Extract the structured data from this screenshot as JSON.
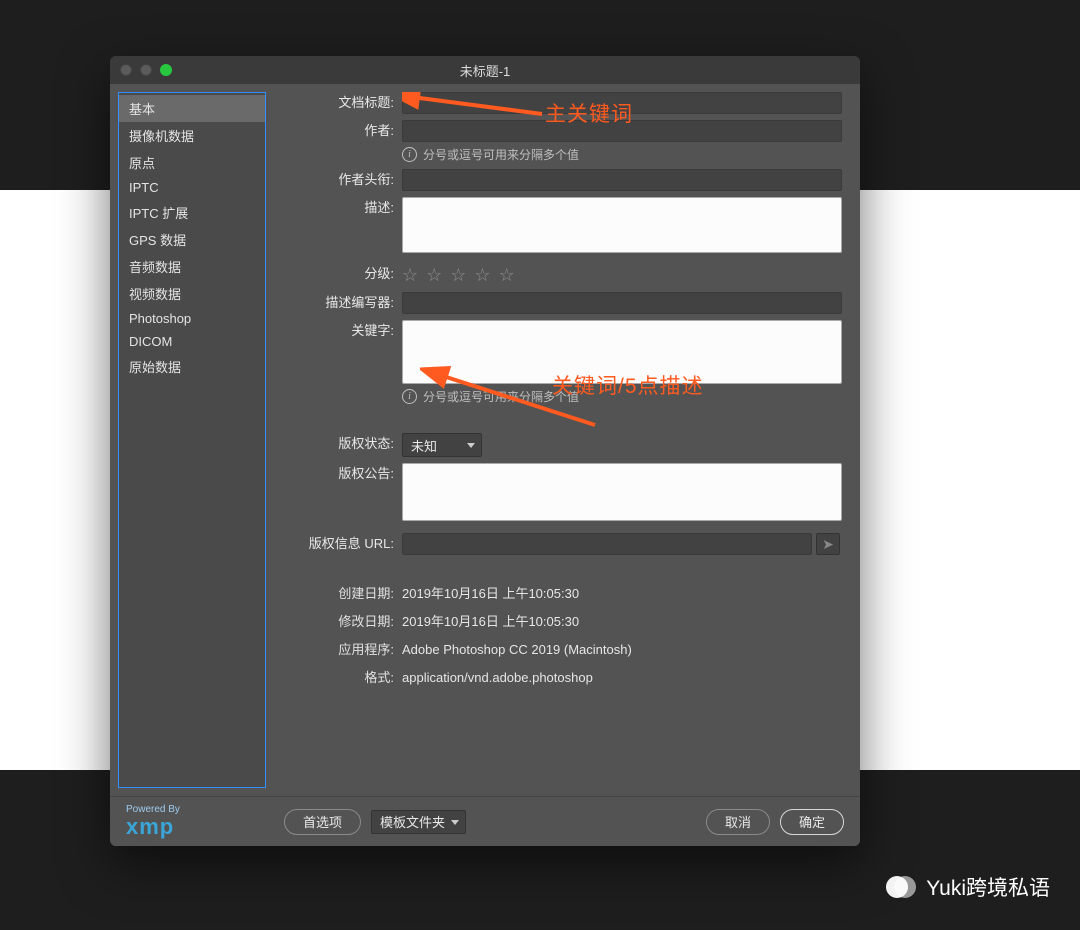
{
  "window": {
    "title": "未标题-1"
  },
  "sidebar": {
    "items": [
      {
        "label": "基本",
        "selected": true
      },
      {
        "label": "摄像机数据"
      },
      {
        "label": "原点"
      },
      {
        "label": "IPTC"
      },
      {
        "label": "IPTC 扩展"
      },
      {
        "label": "GPS 数据"
      },
      {
        "label": "音频数据"
      },
      {
        "label": "视频数据"
      },
      {
        "label": "Photoshop"
      },
      {
        "label": "DICOM"
      },
      {
        "label": "原始数据"
      }
    ]
  },
  "form": {
    "doc_title_label": "文档标题:",
    "author_label": "作者:",
    "multi_hint": "分号或逗号可用来分隔多个值",
    "author_title_label": "作者头衔:",
    "description_label": "描述:",
    "rating_label": "分级:",
    "desc_writer_label": "描述编写器:",
    "keywords_label": "关键字:",
    "copyright_status_label": "版权状态:",
    "copyright_status_value": "未知",
    "copyright_notice_label": "版权公告:",
    "copyright_url_label": "版权信息 URL:",
    "created_label": "创建日期:",
    "created_value": "2019年10月16日 上午10:05:30",
    "modified_label": "修改日期:",
    "modified_value": "2019年10月16日 上午10:05:30",
    "app_label": "应用程序:",
    "app_value": "Adobe Photoshop CC 2019 (Macintosh)",
    "format_label": "格式:",
    "format_value": "application/vnd.adobe.photoshop"
  },
  "footer": {
    "powered_by": "Powered By",
    "xmp": "xmp",
    "prefs": "首选项",
    "templates": "模板文件夹",
    "cancel": "取消",
    "ok": "确定"
  },
  "annotations": {
    "a1": "主关键词",
    "a2": "关键词/5点描述"
  },
  "watermark": "Yuki跨境私语"
}
